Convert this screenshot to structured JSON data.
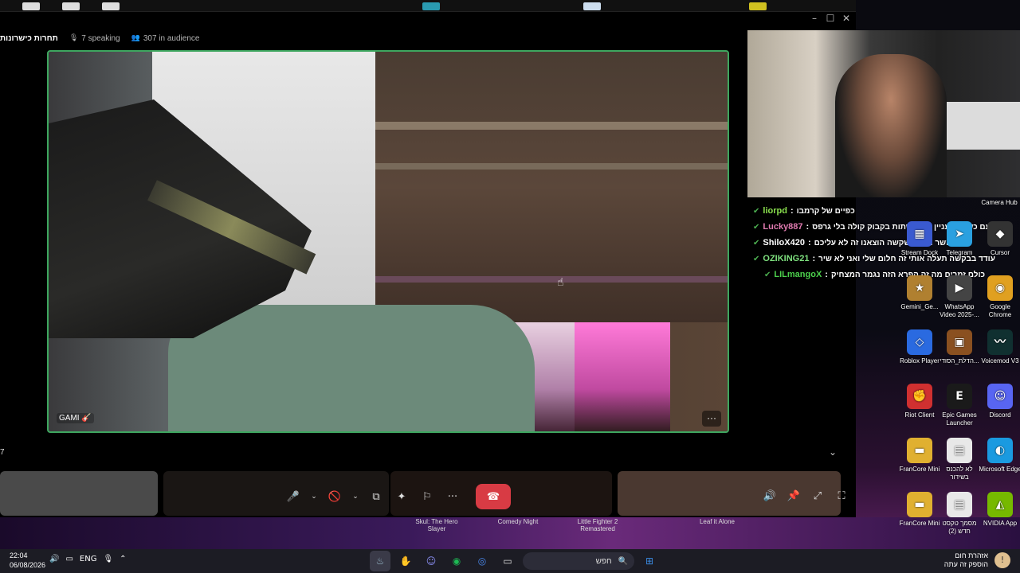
{
  "window": {
    "controls": [
      "–",
      "☐",
      "✕"
    ]
  },
  "header": {
    "channel_name": "תחרות כישרונות",
    "speaking": "7 speaking",
    "audience": "307 in audience"
  },
  "main_video": {
    "participant_label": "GAMI 🎸",
    "more_label": "···"
  },
  "sidebar_count": "7",
  "controls": {
    "mic": "🎤",
    "mic_menu": "⌄",
    "camera": "🚫",
    "camera_menu": "⌄",
    "screen_share": "⧉",
    "activity": "✦",
    "soundboard": "⚐",
    "more": "···",
    "hangup": "☎",
    "volume": "🔊",
    "pin": "📌",
    "popout": "⤢",
    "fullscreen": "⛶"
  },
  "chat": [
    {
      "user": "liorpd",
      "user_color": "#8be04e",
      "message": "כפיים של קרמבו"
    },
    {
      "user": "Lucky887",
      "user_color": "#e07ab0",
      "message": "עם כשרון מעניין כמו לשתות בקבוק קולה בלי גרפס"
    },
    {
      "user": "ShiloX420",
      "user_color": "#ffffff",
      "message": "השר היחיד שקשה הוצאנו זה לא עליכם"
    },
    {
      "user": "OZIKING21",
      "user_color": "#7ee07e",
      "message": "עודד בבקשה תעלה אותי זה חלום שלי ואני לא שיר"
    },
    {
      "user": "LILmangoX",
      "user_color": "#4cd04c",
      "message": "כולם זמרים מה זה הפרא הזה נגמר המצחיק"
    }
  ],
  "desktop_icons": [
    {
      "label": "Stream Dock",
      "glyph": "▦",
      "color": "#3a5ad0"
    },
    {
      "label": "Telegram",
      "glyph": "➤",
      "color": "#2aa0e0"
    },
    {
      "label": "Cursor",
      "glyph": "◆",
      "color": "#333333"
    },
    {
      "label": "Gemini_Ge...",
      "glyph": "★",
      "color": "#b08030"
    },
    {
      "label": "WhatsApp Video 2025-...",
      "glyph": "▶",
      "color": "#444444"
    },
    {
      "label": "Google Chrome",
      "glyph": "◉",
      "color": "#e0a020"
    },
    {
      "label": "Roblox Player",
      "glyph": "◇",
      "color": "#2a6ae0"
    },
    {
      "label": "הדלת_הסודי...",
      "glyph": "▣",
      "color": "#8a5020"
    },
    {
      "label": "Voicemod V3",
      "glyph": "〰",
      "color": "#103030"
    },
    {
      "label": "Riot Client",
      "glyph": "✊",
      "color": "#d03030"
    },
    {
      "label": "Epic Games Launcher",
      "glyph": "E",
      "color": "#1a1a1a"
    },
    {
      "label": "Discord",
      "glyph": "☺",
      "color": "#5865f2"
    },
    {
      "label": "FranCore Mini",
      "glyph": "▬",
      "color": "#e0b030"
    },
    {
      "label": "לא להכנס בשידור",
      "glyph": "▤",
      "color": "#e8e8e8"
    },
    {
      "label": "Microsoft Edge",
      "glyph": "◐",
      "color": "#1a9ae0"
    },
    {
      "label": "FranCore Mini",
      "glyph": "▬",
      "color": "#e0b030"
    },
    {
      "label": "מסמך טקסט חדש (2)",
      "glyph": "▤",
      "color": "#e8e8e8"
    },
    {
      "label": "NVIDIA App",
      "glyph": "◭",
      "color": "#76b900"
    }
  ],
  "camera_hub_label": "Camera Hub",
  "game_labels": [
    "Skul: The Hero Slayer",
    "Comedy Night",
    "Little Fighter 2 Remastered",
    "Leaf it Alone"
  ],
  "taskbar": {
    "time": "22:04",
    "date": "06/08/2026",
    "lang": "ENG",
    "search_placeholder": "חפש",
    "weather_title": "אזהרת חום",
    "weather_sub": "הוספק זה עתה"
  }
}
